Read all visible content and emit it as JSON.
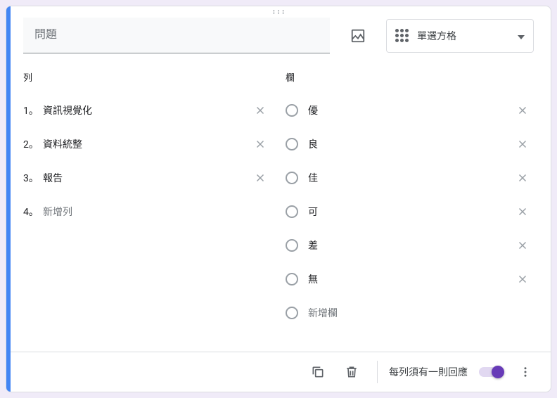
{
  "question": {
    "placeholder": "問題",
    "value": ""
  },
  "typeSelect": {
    "label": "單選方格"
  },
  "rowsHeader": "列",
  "colsHeader": "欄",
  "rows": [
    {
      "num": "1。",
      "label": "資訊視覺化"
    },
    {
      "num": "2。",
      "label": "資料統整"
    },
    {
      "num": "3。",
      "label": "報告"
    }
  ],
  "addRow": {
    "num": "4。",
    "label": "新增列"
  },
  "cols": [
    {
      "label": "優"
    },
    {
      "label": "良"
    },
    {
      "label": "佳"
    },
    {
      "label": "可"
    },
    {
      "label": "差"
    },
    {
      "label": "無"
    }
  ],
  "addCol": {
    "label": "新增欄"
  },
  "footer": {
    "requiredLabel": "每列須有一則回應"
  }
}
